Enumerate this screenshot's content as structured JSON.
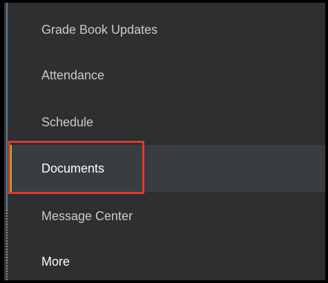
{
  "sidebar": {
    "items": [
      {
        "label": "Grade Book Updates",
        "state": "default"
      },
      {
        "label": "Attendance",
        "state": "default"
      },
      {
        "label": "Schedule",
        "state": "default"
      },
      {
        "label": "Documents",
        "state": "active"
      },
      {
        "label": "Message Center",
        "state": "default"
      },
      {
        "label": "More",
        "state": "expandable"
      }
    ]
  },
  "colors": {
    "background": "#2d2f31",
    "active_background": "#3a3d40",
    "active_indicator": "#9bbd4f",
    "highlight_border": "#e03a2e",
    "text_default": "#c9cbcd",
    "text_active": "#ffffff"
  }
}
